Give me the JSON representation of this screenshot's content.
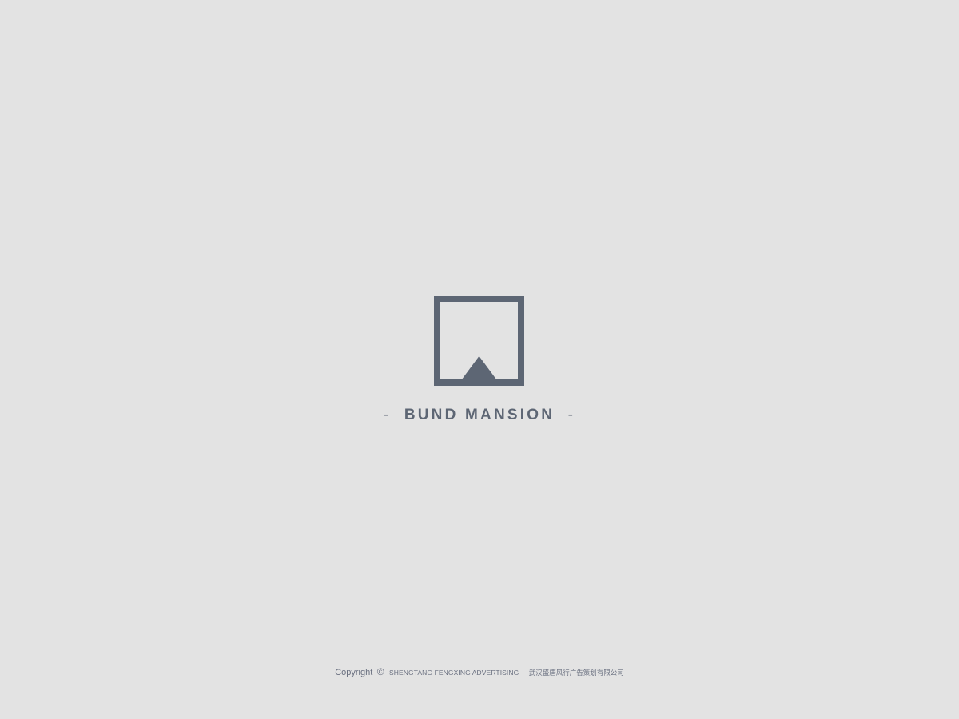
{
  "brand": {
    "dash_left": "-",
    "name": "BUND MANSION",
    "dash_right": "-",
    "color": "#5d6674"
  },
  "logo": {
    "icon": "square-frame-peak-icon",
    "color": "#5d6674"
  },
  "footer": {
    "copyright_label": "Copyright",
    "copyright_symbol": "©",
    "company_en": "SHENGTANG FENGXING ADVERTISING",
    "company_cn": "武汉盛唐风行广告策划有限公司"
  },
  "colors": {
    "background": "#e3e3e3",
    "text": "#5d6674"
  }
}
